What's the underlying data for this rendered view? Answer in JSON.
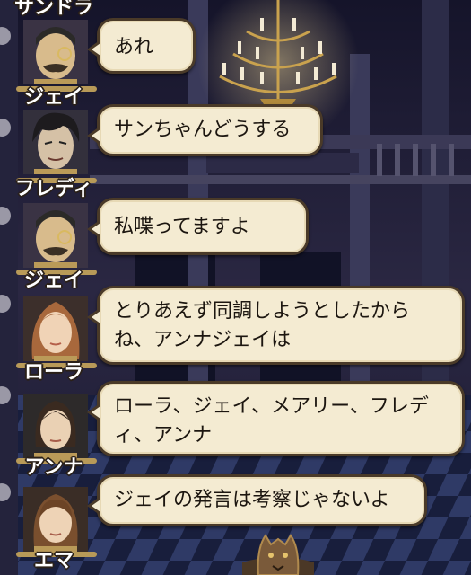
{
  "messages": [
    {
      "speaker": "サンドラ",
      "text": ""
    },
    {
      "speaker": "ジェイ",
      "text": "あれ"
    },
    {
      "speaker": "フレディ",
      "text": "サンちゃんどうする"
    },
    {
      "speaker": "ジェイ",
      "text": "私喋ってますよ"
    },
    {
      "speaker": "ローラ",
      "text": "とりあえず同調しようとしたからね、アンナジェイは"
    },
    {
      "speaker": "アンナ",
      "text": "ローラ、ジェイ、メアリー、フレディ、アンナ"
    },
    {
      "speaker": "エマ",
      "text": "ジェイの発言は考察じゃないよ"
    }
  ],
  "colors": {
    "bubble": "#f4ebd2",
    "bubble_border": "#4a3a28",
    "name_outline": "#2a2018"
  },
  "icons": [
    "jay-portrait-icon",
    "freddy-portrait-icon",
    "laura-portrait-icon",
    "anna-portrait-icon",
    "emma-portrait-icon",
    "wolf-crest-icon"
  ]
}
